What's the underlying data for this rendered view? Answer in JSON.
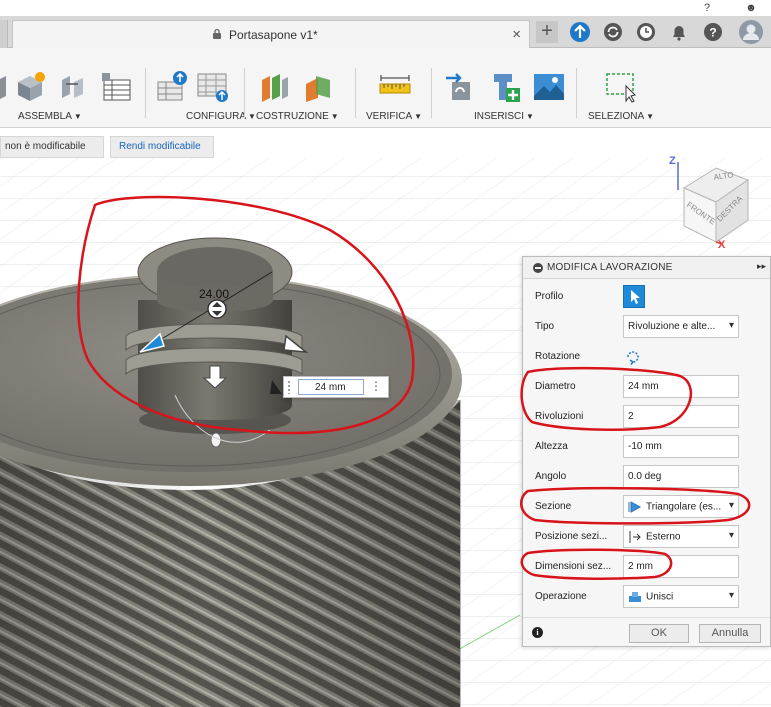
{
  "window": {
    "tab_title": "Portasapone v1*",
    "close_glyph": "×",
    "new_tab_glyph": "+"
  },
  "icons": {
    "lock": "lock-icon",
    "notifications": "bell-icon",
    "help": "help-icon",
    "profile": "avatar"
  },
  "ribbon": {
    "groups": [
      {
        "label": "ASSEMBLA"
      },
      {
        "label": "CONFIGURA"
      },
      {
        "label": "COSTRUZIONE"
      },
      {
        "label": "VERIFICA"
      },
      {
        "label": "INSERISCI"
      },
      {
        "label": "SELEZIONA"
      }
    ]
  },
  "info": {
    "readonly_text": "non è modificabile",
    "make_editable_link": "Rendi modificabile"
  },
  "viewcube": {
    "top": "ALTO",
    "front": "FRONTE",
    "right": "DESTRA",
    "axis_z": "Z",
    "axis_x": "X"
  },
  "canvas": {
    "dimension_label": "24.00",
    "dim_input_value": "24 mm",
    "more_glyph": "⋮"
  },
  "panel": {
    "title": "MODIFICA LAVORAZIONE",
    "expand_glyph": "▸▸",
    "rows": {
      "profilo": {
        "label": "Profilo"
      },
      "tipo": {
        "label": "Tipo",
        "value": "Rivoluzione e alte..."
      },
      "rotazione": {
        "label": "Rotazione"
      },
      "diametro": {
        "label": "Diametro",
        "value": "24 mm"
      },
      "rivoluzioni": {
        "label": "Rivoluzioni",
        "value": "2"
      },
      "altezza": {
        "label": "Altezza",
        "value": "-10 mm"
      },
      "angolo": {
        "label": "Angolo",
        "value": "0.0 deg"
      },
      "sezione": {
        "label": "Sezione",
        "value": "Triangolare (es..."
      },
      "posizione": {
        "label": "Posizione sezi...",
        "value": "Esterno"
      },
      "dimensioni": {
        "label": "Dimensioni sez...",
        "value": "2 mm"
      },
      "operazione": {
        "label": "Operazione",
        "value": "Unisci"
      }
    },
    "info_glyph": "i",
    "ok_label": "OK",
    "cancel_label": "Annulla"
  },
  "colors": {
    "accent": "#1f8ad8",
    "annotation": "#d8141b",
    "model": "#7d7b72"
  }
}
